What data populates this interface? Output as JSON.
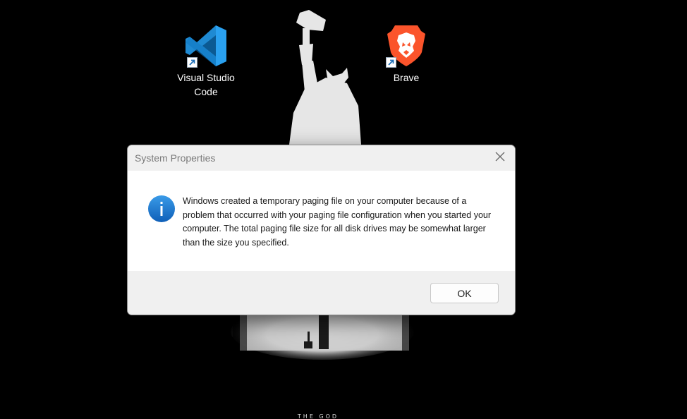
{
  "desktop": {
    "icons": [
      {
        "label": "Visual Studio Code",
        "icon": "vscode-icon",
        "shortcut": true
      },
      {
        "label": "Brave",
        "icon": "brave-lion-icon",
        "shortcut": true
      }
    ],
    "wallpaper": {
      "caption": "THE GOD",
      "description_icon": "thor-hammer-silhouette"
    }
  },
  "dialog": {
    "title": "System Properties",
    "icon": "info-icon",
    "message": "Windows created a temporary paging file on your computer because of a problem that occurred with your paging file configuration when you started your computer.  The total paging file size for all disk drives may be somewhat larger than the size you specified.",
    "ok_label": "OK",
    "close_icon": "close-icon"
  },
  "colors": {
    "desktop_bg": "#000000",
    "dialog_bg": "#ffffff",
    "dialog_chrome": "#f0f0f0",
    "info_blue": "#1f7fd6",
    "vscode_blue": "#2aa1f0",
    "brave_orange": "#fb542b"
  }
}
